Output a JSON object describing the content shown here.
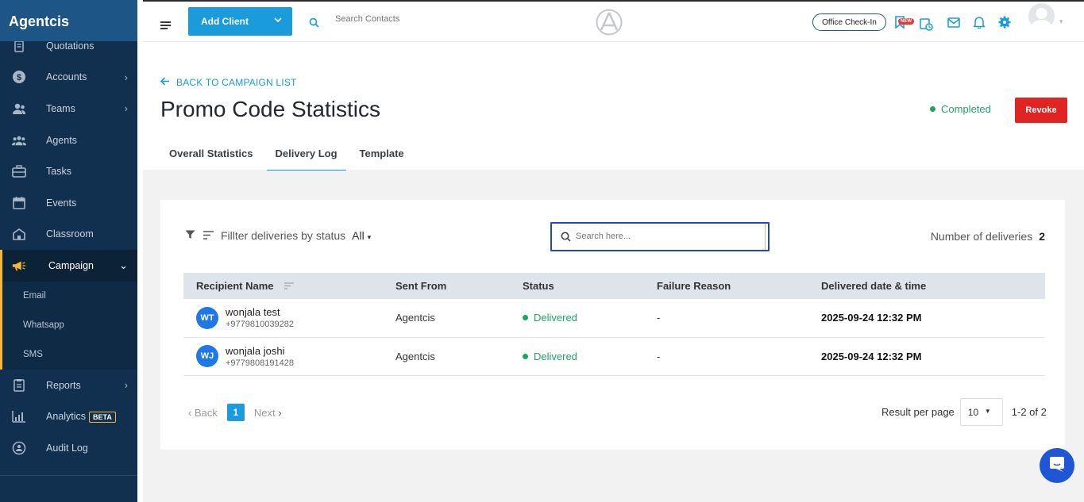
{
  "app": {
    "brand": "Agentcis"
  },
  "sidebar": {
    "items": [
      {
        "label": "Quotations",
        "icon": "clipboard-icon",
        "chevron": false
      },
      {
        "label": "Accounts",
        "icon": "dollar-icon",
        "chevron": true
      },
      {
        "label": "Teams",
        "icon": "team-icon",
        "chevron": true
      },
      {
        "label": "Agents",
        "icon": "agents-icon",
        "chevron": false
      },
      {
        "label": "Tasks",
        "icon": "briefcase-icon",
        "chevron": false
      },
      {
        "label": "Events",
        "icon": "calendar-icon",
        "chevron": false
      },
      {
        "label": "Classroom",
        "icon": "classroom-icon",
        "chevron": false
      },
      {
        "label": "Campaign",
        "icon": "megaphone-icon",
        "chevron": true,
        "active": true
      }
    ],
    "sub_items": [
      "Email",
      "Whatsapp",
      "SMS"
    ],
    "items_after": [
      {
        "label": "Reports",
        "icon": "reports-icon",
        "chevron": true
      },
      {
        "label": "Analytics",
        "icon": "analytics-icon",
        "badge": "BETA"
      },
      {
        "label": "Audit Log",
        "icon": "audit-icon"
      }
    ]
  },
  "topbar": {
    "add_client_label": "Add Client",
    "search_placeholder": "Search Contacts",
    "checkin_label": "Office Check-In",
    "new_badge": "NEW"
  },
  "header": {
    "back_label": "BACK TO CAMPAIGN LIST",
    "title": "Promo Code Statistics",
    "status": "Completed",
    "revoke_label": "Revoke",
    "tabs": [
      "Overall Statistics",
      "Delivery Log",
      "Template"
    ],
    "active_tab": "Delivery Log"
  },
  "delivery": {
    "filter_label": "Fillter deliveries by status",
    "filter_value": "All",
    "search_placeholder": "Search here...",
    "count_label": "Number of deliveries",
    "count": "2",
    "columns": [
      "Recipient Name",
      "Sent From",
      "Status",
      "Failure Reason",
      "Delivered date & time"
    ],
    "rows": [
      {
        "initials": "WT",
        "name": "wonjala test",
        "phone": "+9779810039282",
        "sent_from": "Agentcis",
        "status": "Delivered",
        "failure": "-",
        "delivered_at": "2025-09-24 12:32 PM"
      },
      {
        "initials": "WJ",
        "name": "wonjala joshi",
        "phone": "+9779808191428",
        "sent_from": "Agentcis",
        "status": "Delivered",
        "failure": "-",
        "delivered_at": "2025-09-24 12:32 PM"
      }
    ],
    "pager": {
      "back": "Back",
      "page": "1",
      "next": "Next"
    },
    "rpp_label": "Result per page",
    "rpp_value": "10",
    "range": "1-2 of 2"
  },
  "colors": {
    "accent": "#1a9bdc",
    "sidebar": "#11304f",
    "danger": "#e02424",
    "success": "#21a366"
  }
}
